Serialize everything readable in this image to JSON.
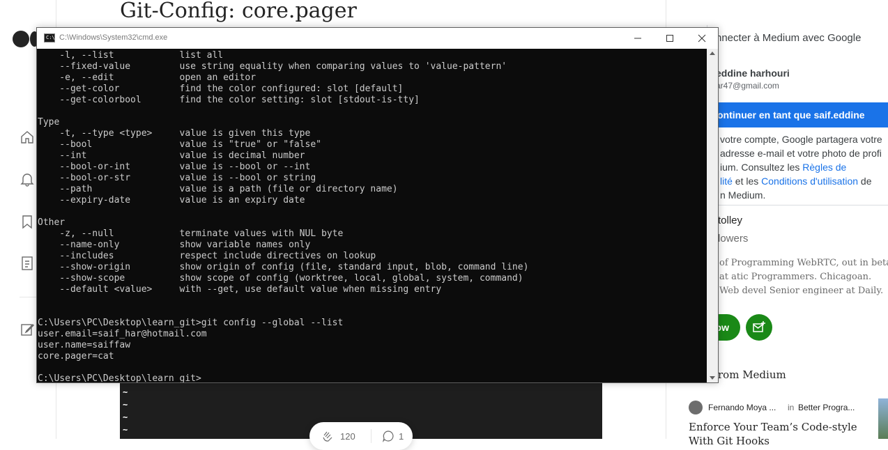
{
  "medium": {
    "article_title": "Git-Config: core.pager",
    "code_lines": [
      "~",
      "~",
      "~",
      "~"
    ],
    "claps": "120",
    "responses": "1"
  },
  "google_panel": {
    "title": "nnecter à Medium avec Google",
    "account_name": "eddine harhouri",
    "account_email": "ar47@gmail.com",
    "continue_button": "ontinuer en tant que saif.eddine",
    "info_line1": "votre compte, Google partagera votre",
    "info_line2": "adresse e-mail et votre photo de profi",
    "info_line3_pre": "ium. Consultez les ",
    "info_link1a": "Règles de",
    "info_link1b": "lité",
    "info_mid": " et les ",
    "info_link2": "Conditions d'utilisation",
    "info_post": " de",
    "info_line5": "n Medium."
  },
  "author": {
    "name": "tolley",
    "followers": "lowers",
    "bio": "of Programming WebRTC, out in beta at atic Programmers. Chicagoan. Web devel Senior engineer at Daily.",
    "follow_label": "ow"
  },
  "more_from": {
    "heading": "rom Medium",
    "rec_author": "Fernando Moya ...",
    "rec_in": "in",
    "rec_publication": "Better Progra...",
    "rec_title_line1": "Enforce Your Team’s Code-style",
    "rec_title_line2": "With Git Hooks"
  },
  "cmd": {
    "window_title": "C:\\Windows\\System32\\cmd.exe",
    "app_icon_text": "C:\\",
    "output": "    -l, --list            list all\n    --fixed-value         use string equality when comparing values to 'value-pattern'\n    -e, --edit            open an editor\n    --get-color           find the color configured: slot [default]\n    --get-colorbool       find the color setting: slot [stdout-is-tty]\n\nType\n    -t, --type <type>     value is given this type\n    --bool                value is \"true\" or \"false\"\n    --int                 value is decimal number\n    --bool-or-int         value is --bool or --int\n    --bool-or-str         value is --bool or string\n    --path                value is a path (file or directory name)\n    --expiry-date         value is an expiry date\n\nOther\n    -z, --null            terminate values with NUL byte\n    --name-only           show variable names only\n    --includes            respect include directives on lookup\n    --show-origin         show origin of config (file, standard input, blob, command line)\n    --show-scope          show scope of config (worktree, local, global, system, command)\n    --default <value>     with --get, use default value when missing entry\n\n\nC:\\Users\\PC\\Desktop\\learn_git>git config --global --list\nuser.email=saif_har@hotmail.com\nuser.name=saiffaw\ncore.pager=cat\n\nC:\\Users\\PC\\Desktop\\learn_git>"
  },
  "colors": {
    "terminal_bg": "#0c0c0c",
    "terminal_fg": "#cccccc",
    "google_blue": "#1a73e8",
    "medium_green": "#1a8917"
  }
}
